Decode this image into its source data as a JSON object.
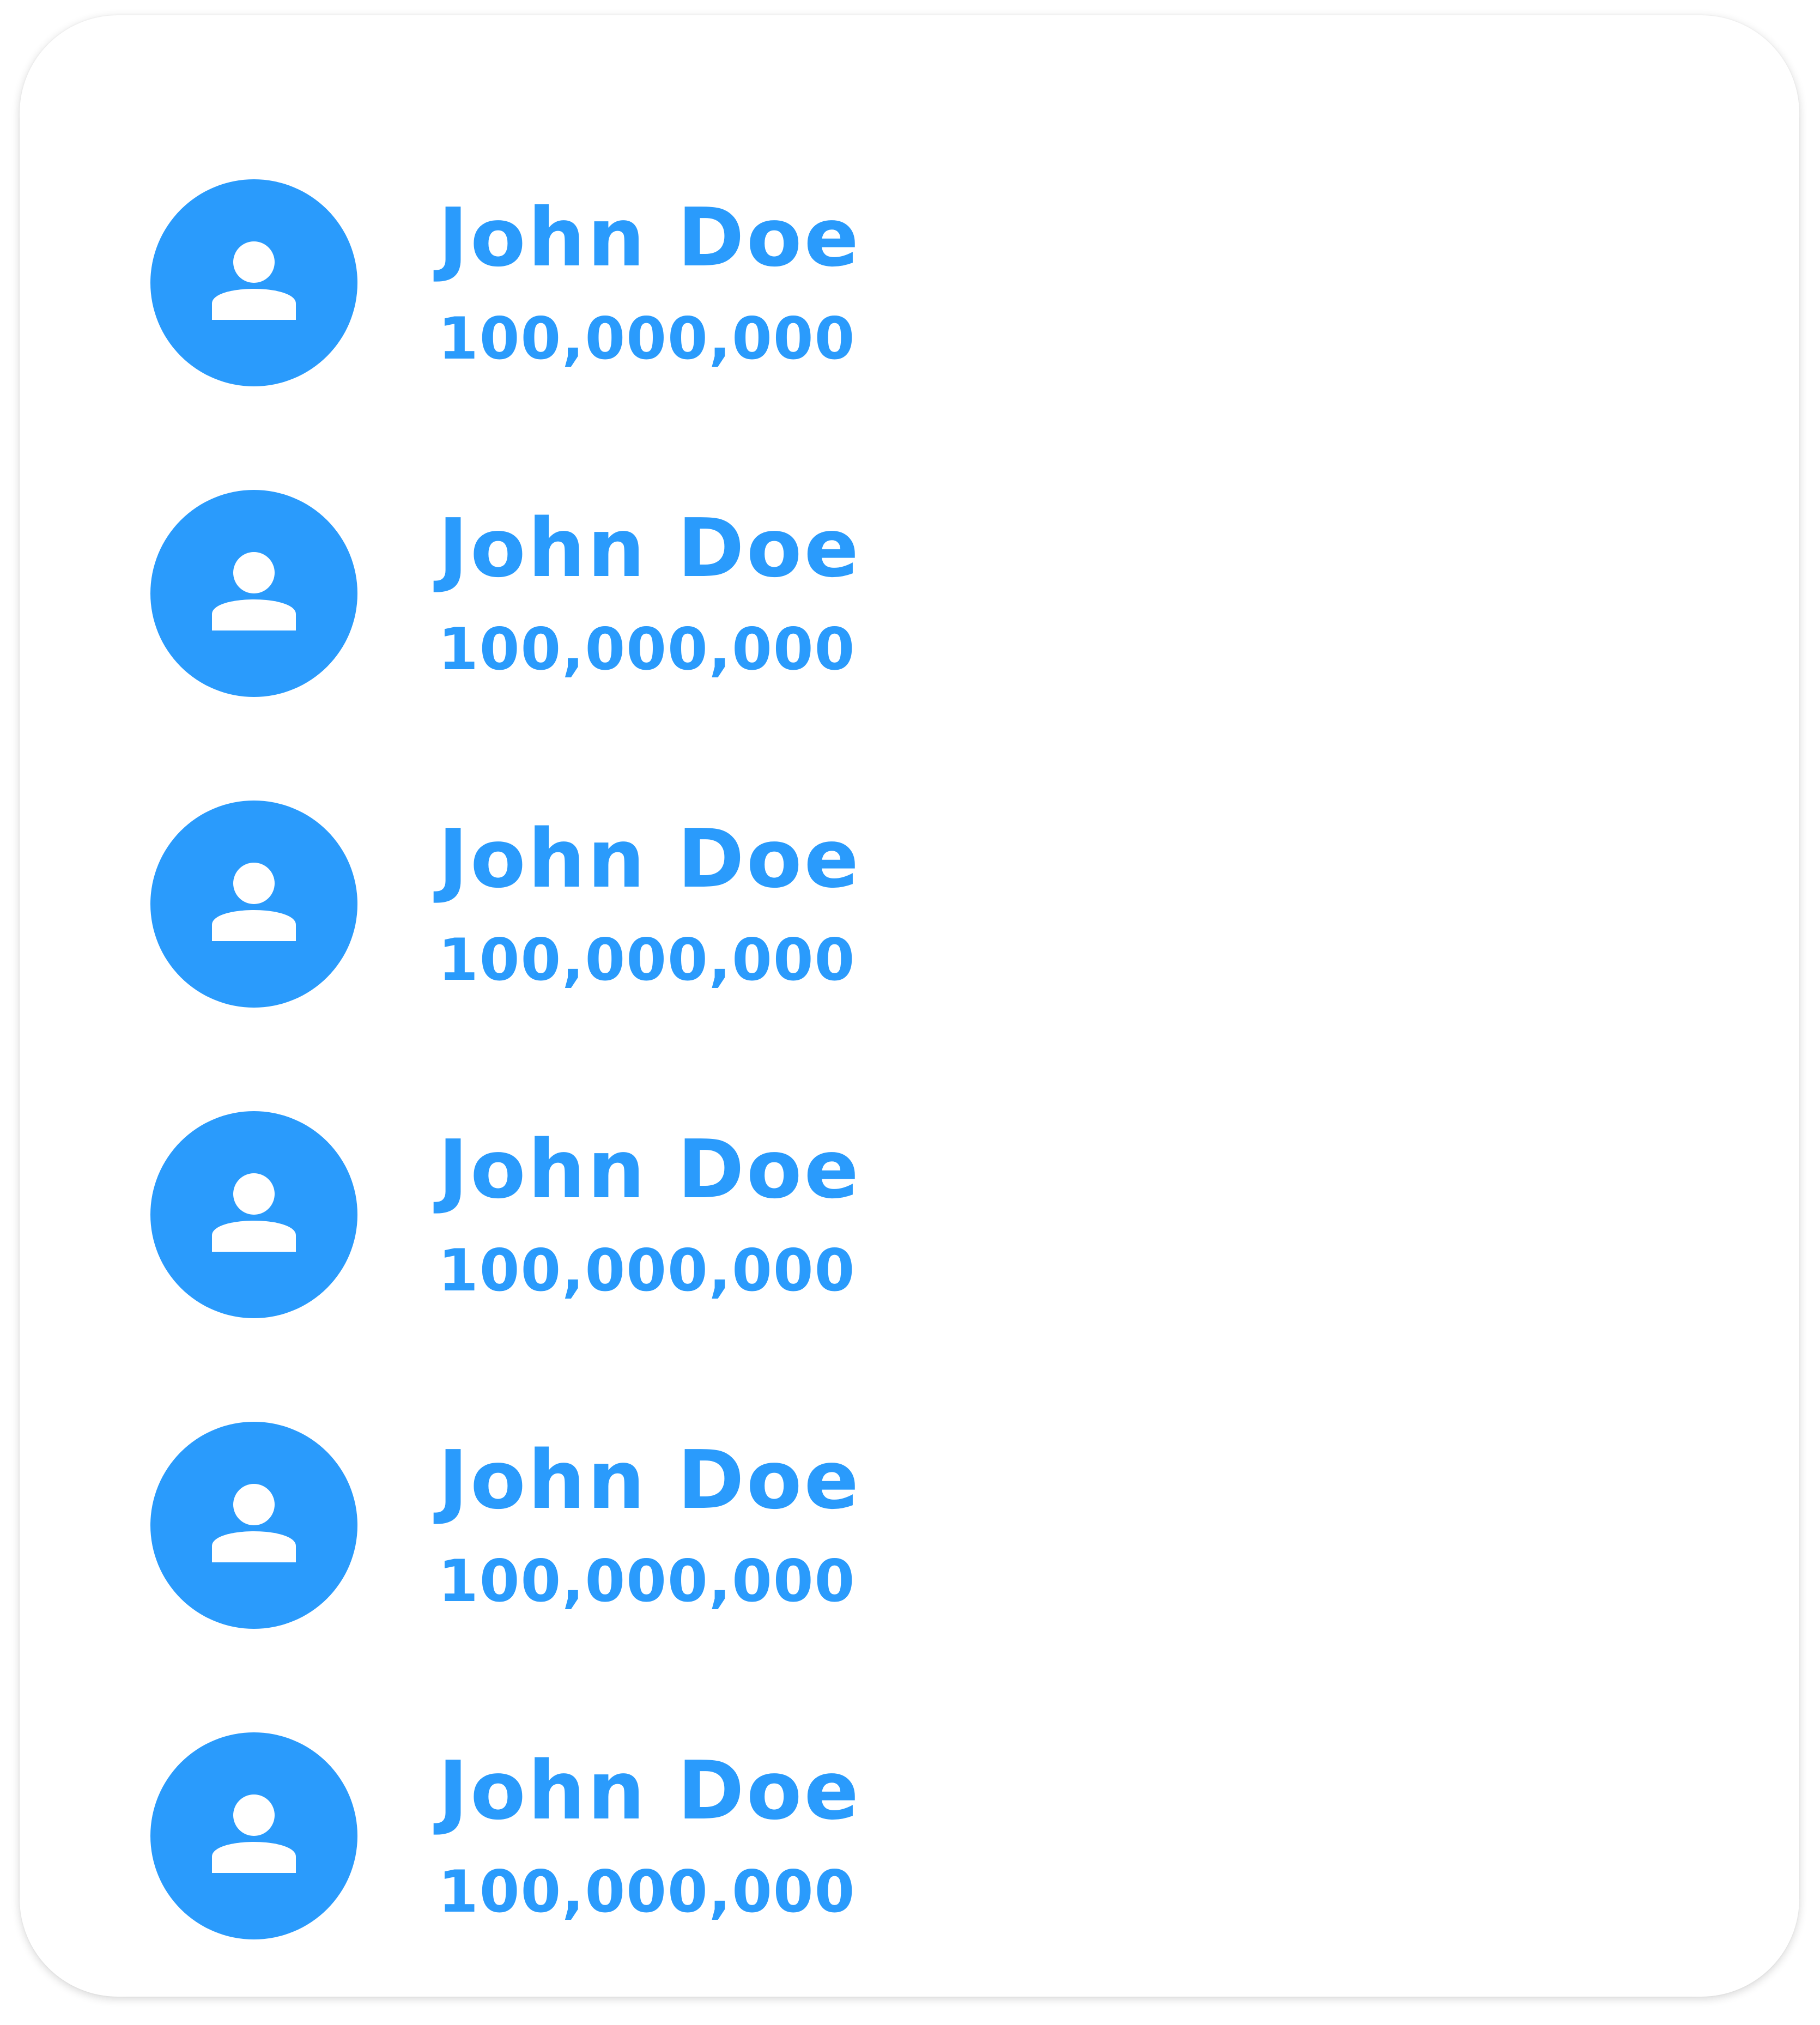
{
  "colors": {
    "accent": "#2A9BFC",
    "card_background": "#FFFFFF",
    "icon_foreground": "#FFFFFF"
  },
  "users": [
    {
      "name": "John Doe",
      "amount": "100,000,000",
      "icon": "person-icon"
    },
    {
      "name": "John Doe",
      "amount": "100,000,000",
      "icon": "person-icon"
    },
    {
      "name": "John Doe",
      "amount": "100,000,000",
      "icon": "person-icon"
    },
    {
      "name": "John Doe",
      "amount": "100,000,000",
      "icon": "person-icon"
    },
    {
      "name": "John Doe",
      "amount": "100,000,000",
      "icon": "person-icon"
    },
    {
      "name": "John Doe",
      "amount": "100,000,000",
      "icon": "person-icon"
    }
  ]
}
